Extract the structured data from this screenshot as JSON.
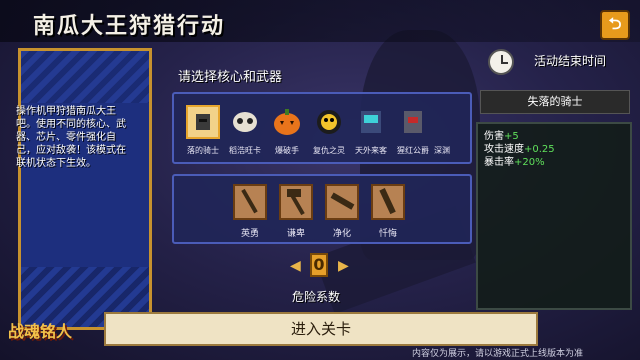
{
  "title": "南瓜大王狩猎行动",
  "banner": {
    "description": "操作机甲狩猎南瓜大王吧。使用不同的核心、武器、芯片、零件强化自己，应对敌袭！该模式在联机状态下生效。"
  },
  "select_prompt": "请选择核心和武器",
  "cores": [
    {
      "label": "落的骑士",
      "icon": "knight-helmet-icon",
      "selected": true
    },
    {
      "label": "稻浩旺卡",
      "icon": "skull-icon",
      "selected": false
    },
    {
      "label": "爆破手",
      "icon": "pumpkin-icon",
      "selected": false
    },
    {
      "label": "复仇之灵",
      "icon": "ghost-icon",
      "selected": false
    },
    {
      "label": "天外来客",
      "icon": "robot-icon",
      "selected": false
    },
    {
      "label": "猩红公爵",
      "icon": "demon-icon",
      "selected": false
    },
    {
      "label": "深渊",
      "icon": "abyss-icon",
      "selected": false
    }
  ],
  "weapons": [
    {
      "label": "英勇",
      "icon": "sword-icon"
    },
    {
      "label": "谦卑",
      "icon": "hammer-icon"
    },
    {
      "label": "净化",
      "icon": "gun-icon"
    },
    {
      "label": "忏悔",
      "icon": "blade-icon"
    }
  ],
  "danger": {
    "label": "危险系数",
    "value": "0"
  },
  "enter_button": "进入关卡",
  "event": {
    "end_time_label": "活动结束时间"
  },
  "knight": {
    "name": "失落的骑士",
    "stats": [
      {
        "name": "伤害",
        "value": "+5"
      },
      {
        "name": "攻击速度",
        "value": "+0.25"
      },
      {
        "name": "暴击率",
        "value": "+20%"
      }
    ]
  },
  "logo": "战魂铭人",
  "disclaimer": "内容仅为展示，请以游戏正式上线版本为准"
}
